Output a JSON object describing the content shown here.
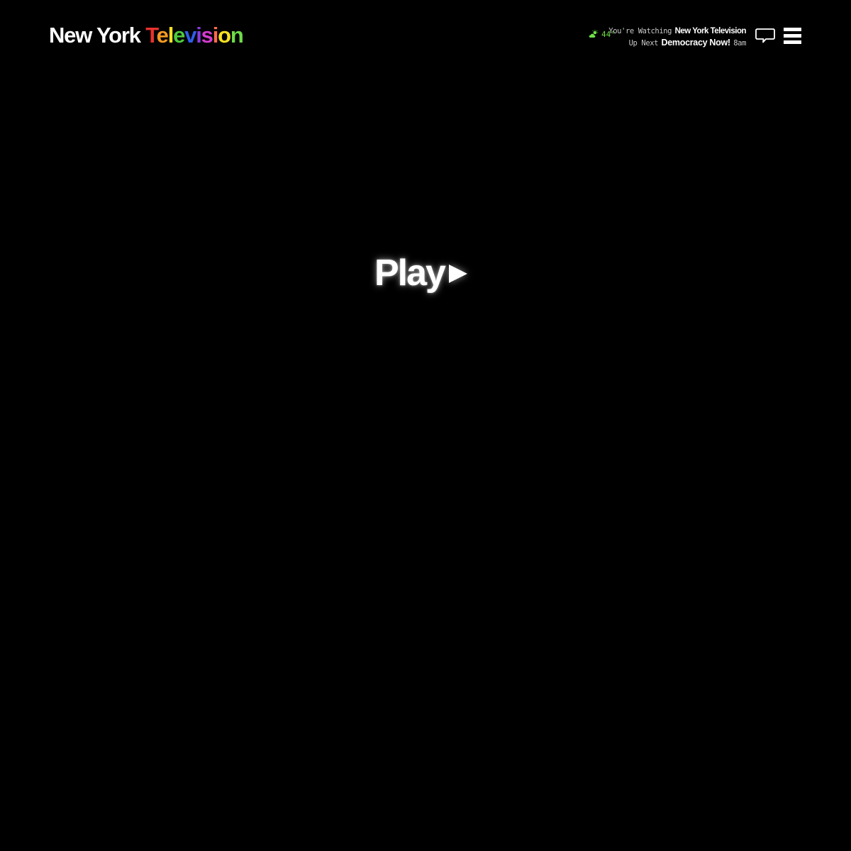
{
  "header": {
    "logo": {
      "main": "New York ",
      "accent_letters": [
        {
          "char": "T",
          "color": "#e8322e"
        },
        {
          "char": "e",
          "color": "#f59a23"
        },
        {
          "char": "l",
          "color": "#f5e023"
        },
        {
          "char": "e",
          "color": "#4fc93c"
        },
        {
          "char": "v",
          "color": "#2f5de8"
        },
        {
          "char": "i",
          "color": "#8a3ae0"
        },
        {
          "char": "s",
          "color": "#d43bd0"
        },
        {
          "char": "i",
          "color": "#ff6a4d"
        },
        {
          "char": "o",
          "color": "#f5e023"
        },
        {
          "char": "n",
          "color": "#6fdc4a"
        }
      ]
    },
    "weather": {
      "icon": "cloud-sun-icon",
      "temperature": "44°",
      "color": "#6fdc4a"
    },
    "now_playing": {
      "watching_label": "You're Watching",
      "watching_title": "New York Television",
      "next_label": "Up Next",
      "next_title": "Democracy Now!",
      "next_time": "8am"
    },
    "chat_icon": "speech-bubble-icon",
    "menu_icon": "hamburger-menu-icon"
  },
  "player": {
    "play_label": "Play",
    "play_icon": "play-triangle-icon"
  }
}
